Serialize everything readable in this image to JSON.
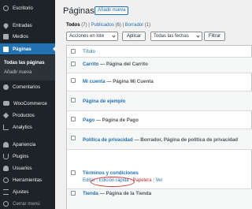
{
  "sidebar": {
    "items": [
      {
        "label": "Escritorio",
        "icon": "dashboard-icon"
      },
      {
        "label": "Entradas",
        "icon": "pushpin-icon"
      },
      {
        "label": "Medios",
        "icon": "media-icon"
      },
      {
        "label": "Páginas",
        "icon": "pages-icon"
      },
      {
        "label": "Comentarios",
        "icon": "comments-icon"
      },
      {
        "label": "WooCommerce",
        "icon": "woocommerce-icon"
      },
      {
        "label": "Productos",
        "icon": "products-icon"
      },
      {
        "label": "Analytics",
        "icon": "analytics-icon"
      },
      {
        "label": "Apariencia",
        "icon": "appearance-icon"
      },
      {
        "label": "Plugins",
        "icon": "plugins-icon"
      },
      {
        "label": "Usuarios",
        "icon": "users-icon"
      },
      {
        "label": "Herramientas",
        "icon": "tools-icon"
      },
      {
        "label": "Ajustes",
        "icon": "settings-icon"
      },
      {
        "label": "Cerrar menú",
        "icon": "collapse-icon"
      }
    ],
    "sub": [
      "Todas las páginas",
      "Añadir nueva"
    ]
  },
  "header": {
    "title": "Páginas",
    "add_new": "Añadir nueva"
  },
  "views": {
    "all": "Todos",
    "all_count": "(7)",
    "published": "Publicados",
    "published_count": "(6)",
    "draft": "Borrador",
    "draft_count": "(1)",
    "sep": "|"
  },
  "filters": {
    "bulk": "Acciones en lote",
    "apply": "Aplicar",
    "dates": "Todas las fechas",
    "filter": "Filtrar"
  },
  "table": {
    "header": "Título",
    "rows": [
      {
        "title": "Carrito",
        "state": "— Página del Carrito"
      },
      {
        "title": "Mi cuenta",
        "state": "— Página Mi Cuenta"
      },
      {
        "title": "Página de ejemplo",
        "state": ""
      },
      {
        "title": "Pago",
        "state": "— Página de Pago"
      },
      {
        "title": "Política de privacidad",
        "state": "— Borrador, Página de política de privacidad"
      },
      {
        "title": "Términos y condiciones",
        "state": ""
      },
      {
        "title": "Tienda",
        "state": "— Página de la Tienda"
      }
    ],
    "row_actions": {
      "edit": "Editar",
      "quick_edit": "Edición rápida",
      "trash": "Papelera",
      "view": "Ver",
      "sep": "|"
    }
  },
  "colors": {
    "accent": "#2271b1",
    "sidebar_bg": "#1d2327",
    "highlight_circle": "#d63638"
  }
}
